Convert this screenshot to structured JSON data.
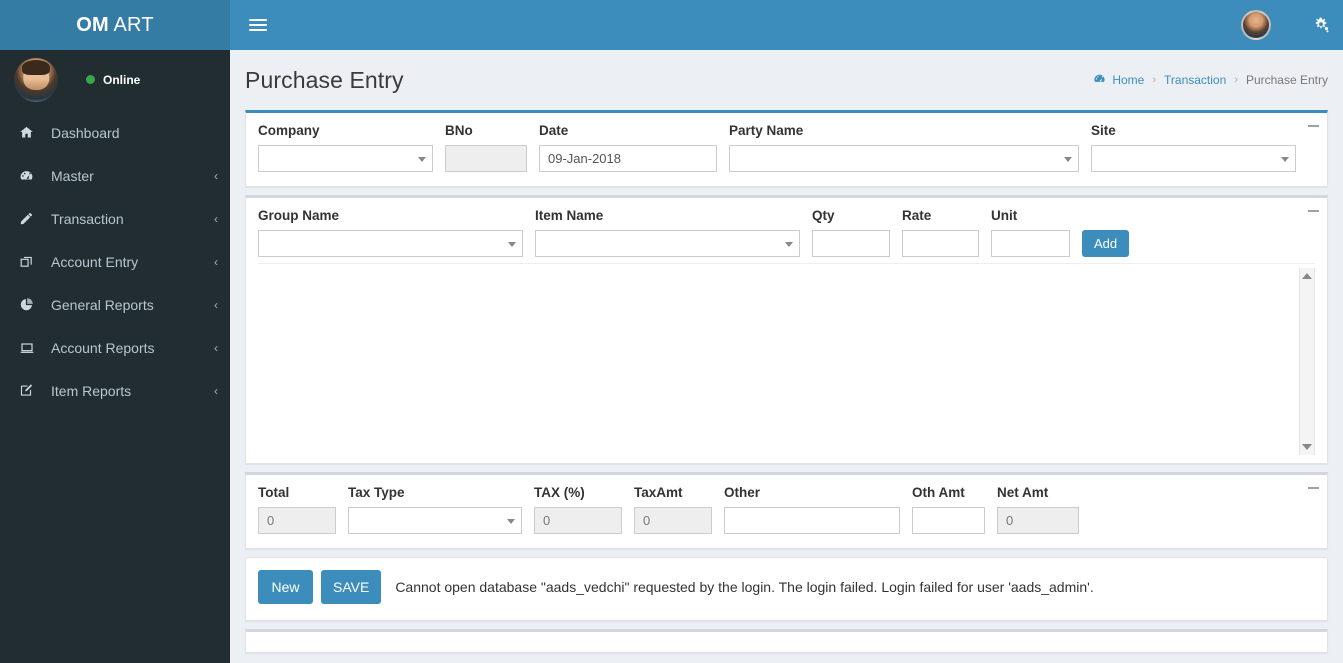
{
  "brand": {
    "bold": "OM",
    "light": " ART"
  },
  "topbar": {
    "toggle_label": "Toggle navigation",
    "avatar_name": "user-avatar",
    "gear_label": "Settings"
  },
  "sidebar": {
    "user": {
      "status": "Online",
      "status_color": "#3ba847"
    },
    "items": [
      {
        "label": "Dashboard",
        "icon": "home-icon",
        "arrow": ""
      },
      {
        "label": "Master",
        "icon": "dashboard-icon",
        "arrow": "‹"
      },
      {
        "label": "Transaction",
        "icon": "pencil-icon",
        "arrow": "‹"
      },
      {
        "label": "Account Entry",
        "icon": "clone-icon",
        "arrow": "‹"
      },
      {
        "label": "General Reports",
        "icon": "pie-chart-icon",
        "arrow": "‹"
      },
      {
        "label": "Account Reports",
        "icon": "laptop-icon",
        "arrow": "‹"
      },
      {
        "label": "Item Reports",
        "icon": "edit-icon",
        "arrow": "‹"
      }
    ]
  },
  "page": {
    "title": "Purchase Entry",
    "breadcrumb": {
      "home": "Home",
      "level2": "Transaction",
      "current": "Purchase Entry",
      "separator": "›"
    }
  },
  "header_panel": {
    "company": {
      "label": "Company",
      "value": "",
      "placeholder": ""
    },
    "bno": {
      "label": "BNo",
      "value": "",
      "disabled": true
    },
    "date": {
      "label": "Date",
      "value": "09-Jan-2018"
    },
    "party_name": {
      "label": "Party Name",
      "value": ""
    },
    "site": {
      "label": "Site",
      "value": ""
    },
    "collapse_icon": "minus-icon"
  },
  "item_panel": {
    "group_name": {
      "label": "Group Name",
      "value": ""
    },
    "item_name": {
      "label": "Item Name",
      "value": ""
    },
    "qty": {
      "label": "Qty",
      "value": ""
    },
    "rate": {
      "label": "Rate",
      "value": ""
    },
    "unit": {
      "label": "Unit",
      "value": ""
    },
    "add_button": "Add",
    "collapse_icon": "minus-icon",
    "grid_rows": []
  },
  "totals_panel": {
    "total": {
      "label": "Total",
      "value": "0",
      "disabled": true
    },
    "tax_type": {
      "label": "Tax Type",
      "value": ""
    },
    "tax_pct": {
      "label": "TAX (%)",
      "value": "0",
      "disabled": true
    },
    "tax_amt": {
      "label": "TaxAmt",
      "value": "0",
      "disabled": true
    },
    "other": {
      "label": "Other",
      "value": ""
    },
    "oth_amt": {
      "label": "Oth Amt",
      "value": ""
    },
    "net_amt": {
      "label": "Net Amt",
      "value": "0",
      "disabled": true
    },
    "collapse_icon": "minus-icon"
  },
  "actions": {
    "new_button": "New",
    "save_button": "SAVE",
    "error_message": "Cannot open database \"aads_vedchi\" requested by the login. The login failed. Login failed for user 'aads_admin'."
  },
  "colors": {
    "header_blue": "#3c8dbc",
    "logo_blue": "#357ca5",
    "sidebar_dark": "#222d32",
    "content_bg": "#ecf0f5",
    "button_blue": "#3c8dbc",
    "status_green": "#3ba847"
  }
}
